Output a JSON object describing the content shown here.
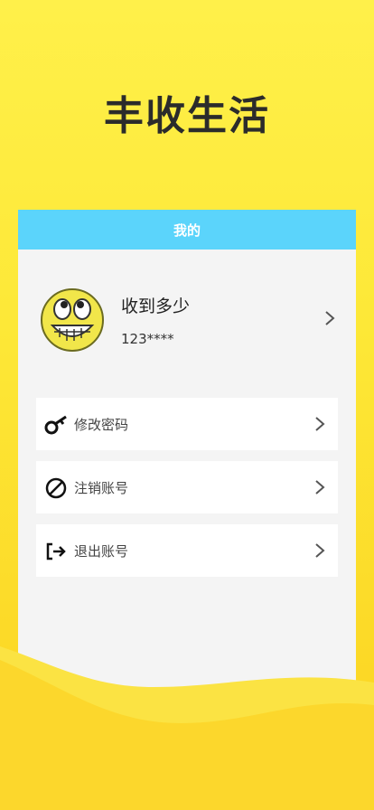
{
  "app_title": "丰收生活",
  "nav": {
    "title": "我的"
  },
  "profile": {
    "name": "收到多少",
    "id": "123****",
    "avatar_icon": "smiley-face-icon"
  },
  "menu": [
    {
      "label": "修改密码",
      "icon": "key-icon"
    },
    {
      "label": "注销账号",
      "icon": "prohibited-icon"
    },
    {
      "label": "退出账号",
      "icon": "logout-icon"
    }
  ],
  "colors": {
    "background": "#fde837",
    "nav_bar": "#5bd4fb",
    "card": "#f4f4f4"
  }
}
